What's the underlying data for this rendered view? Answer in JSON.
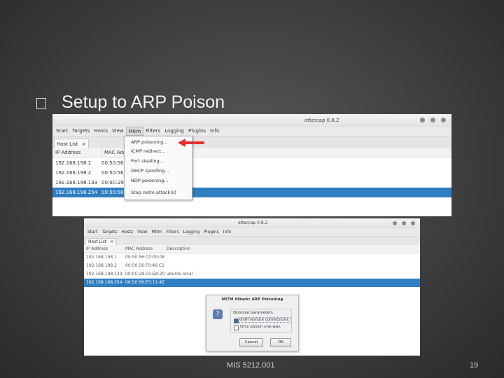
{
  "slide": {
    "title": "Setup to ARP Poison",
    "footer": "MIS 5212.001",
    "page_number": "19",
    "bullet_icon": "square-bullet-icon"
  },
  "window1": {
    "title": "ettercap 0.8.2",
    "menu": [
      "Start",
      "Targets",
      "Hosts",
      "View",
      "Mitm",
      "Filters",
      "Logging",
      "Plugins",
      "Info"
    ],
    "active_menu": "Mitm",
    "tab": "Host List",
    "tab_close": "×",
    "columns": [
      "IP Address",
      "MAC Add"
    ],
    "rows": [
      {
        "ip": "192.168.198.1",
        "mac": "00:50:56"
      },
      {
        "ip": "192.168.198.2",
        "mac": "00:50:56"
      },
      {
        "ip": "192.168.198.133",
        "mac": "00:0C:29"
      },
      {
        "ip": "192.168.198.254",
        "mac": "00:50:56",
        "selected": true
      }
    ],
    "mitm_menu": [
      "ARP poisoning...",
      "ICMP redirect...",
      "Port stealing...",
      "DHCP spoofing...",
      "NDP poisoning...",
      "Stop mitm attack(s)"
    ],
    "arrow_color": "#e03030"
  },
  "window2": {
    "title": "ettercap 0.8.2",
    "menu": [
      "Start",
      "Targets",
      "Hosts",
      "View",
      "Mitm",
      "Filters",
      "Logging",
      "Plugins",
      "Info"
    ],
    "tab": "Host List",
    "tab_close": "×",
    "columns": [
      "IP Address",
      "MAC Address",
      "Description"
    ],
    "rows": [
      {
        "ip": "192.168.198.1",
        "mac": "00:50:56:C0:00:08",
        "desc": ""
      },
      {
        "ip": "192.168.198.2",
        "mac": "00:50:56:F0:46:C1",
        "desc": ""
      },
      {
        "ip": "192.168.198.133",
        "mac": "00:0C:29:31:EA:20",
        "desc": "ubuntu.local"
      },
      {
        "ip": "192.168.198.254",
        "mac": "00:50:56:E5:11:4E",
        "desc": "",
        "selected": true
      }
    ]
  },
  "dialog": {
    "title": "MITM Attack: ARP Poisoning",
    "group_label": "Optional parameters",
    "options": [
      {
        "label": "Sniff remote connections.",
        "checked": true
      },
      {
        "label": "Only poison one-way.",
        "checked": false
      }
    ],
    "cancel": "Cancel",
    "ok": "OK",
    "icon": "question-icon"
  },
  "colors": {
    "selection": "#2f7ec2",
    "slide_background": "#4a4a4a"
  }
}
